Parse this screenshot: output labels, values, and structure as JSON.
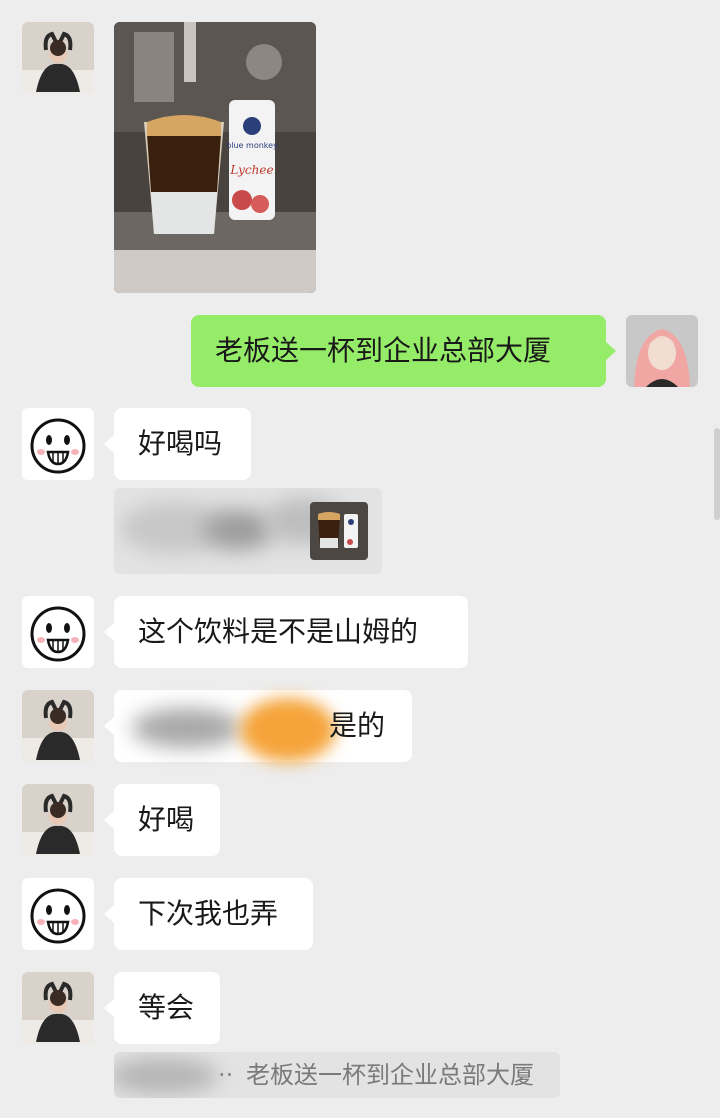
{
  "chat": {
    "messages": [
      {
        "id": "m1",
        "sender": "person-a",
        "type": "image",
        "content": "drink photo with Lychee can"
      },
      {
        "id": "m2",
        "sender": "me",
        "type": "text",
        "text": "老板送一杯到企业总部大厦"
      },
      {
        "id": "m3",
        "sender": "smiley",
        "type": "text",
        "text": "好喝吗"
      },
      {
        "id": "m4",
        "sender": "smiley",
        "type": "quote-image"
      },
      {
        "id": "m5",
        "sender": "smiley",
        "type": "text",
        "text": "这个饮料是不是山姆的"
      },
      {
        "id": "m6",
        "sender": "person-a",
        "type": "text",
        "text": "是的"
      },
      {
        "id": "m7",
        "sender": "person-a",
        "type": "text",
        "text": "好喝"
      },
      {
        "id": "m8",
        "sender": "smiley",
        "type": "text",
        "text": "下次我也弄"
      },
      {
        "id": "m9",
        "sender": "person-a",
        "type": "text",
        "text": "等会"
      },
      {
        "id": "m10",
        "sender": "person-a",
        "type": "quote-text",
        "text": "老板送一杯到企业总部大厦"
      }
    ],
    "can_label": {
      "brand": "blue monkey",
      "flavor": "Lychee"
    },
    "colors": {
      "background": "#ededed",
      "bubble_other": "#ffffff",
      "bubble_me": "#95ec69",
      "text": "#191919",
      "quote_bg": "#e3e3e3",
      "redaction_orange": "#f5a43a"
    },
    "icons": {
      "smiley_avatar": "smiley-face-icon",
      "person_avatar": "person-photo-avatar",
      "my_avatar": "pink-hair-avatar"
    }
  }
}
